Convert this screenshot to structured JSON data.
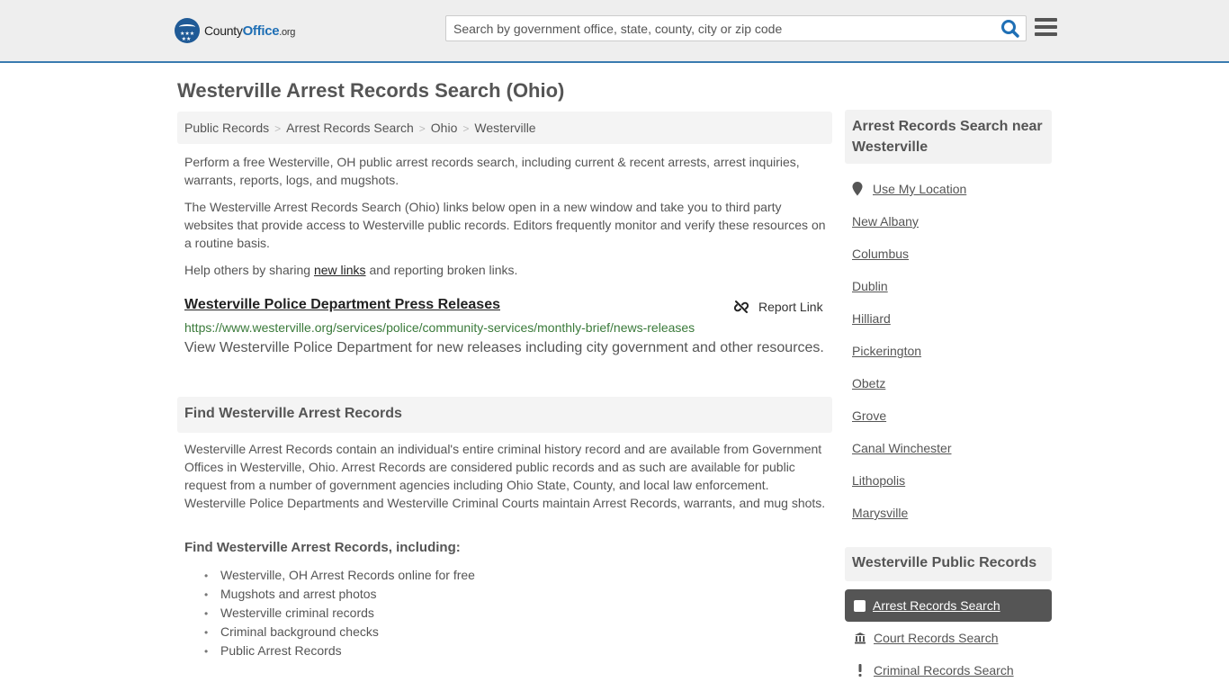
{
  "header": {
    "logo": {
      "name": "County",
      "highlight": "Office",
      "suffix": ".org"
    },
    "search": {
      "placeholder": "Search by government office, state, county, city or zip code",
      "value": ""
    },
    "icons": {
      "search": "search-icon",
      "menu": "hamburger-menu-icon"
    }
  },
  "page": {
    "title": "Westerville Arrest Records Search (Ohio)",
    "breadcrumb": [
      "Public Records",
      "Arrest Records Search",
      "Ohio",
      "Westerville"
    ],
    "intro": [
      "Perform a free Westerville, OH public arrest records search, including current & recent arrests, arrest inquiries, warrants, reports, logs, and mugshots.",
      "The Westerville Arrest Records Search (Ohio) links below open in a new window and take you to third party websites that provide access to Westerville public records. Editors frequently monitor and verify these resources on a routine basis."
    ],
    "share": {
      "before": "Help others by sharing ",
      "link": "new links",
      "after": " and reporting broken links."
    }
  },
  "result": {
    "title": "Westerville Police Department Press Releases",
    "url": "https://www.westerville.org/services/police/community-services/monthly-brief/news-releases",
    "description": "View Westerville Police Department for new releases including city government and other resources.",
    "report_label": "Report Link",
    "report_icon": "broken-link-icon"
  },
  "find_section": {
    "heading": "Find Westerville Arrest Records",
    "body": "Westerville Arrest Records contain an individual's entire criminal history record and are available from Government Offices in Westerville, Ohio. Arrest Records are considered public records and as such are available for public request from a number of government agencies including Ohio State, County, and local law enforcement. Westerville Police Departments and Westerville Criminal Courts maintain Arrest Records, warrants, and mug shots.",
    "subheading": "Find Westerville Arrest Records, including:",
    "items": [
      "Westerville, OH Arrest Records online for free",
      "Mugshots and arrest photos",
      "Westerville criminal records",
      "Criminal background checks",
      "Public Arrest Records"
    ]
  },
  "sidebar": {
    "nearby_heading": "Arrest Records Search near Westerville",
    "use_location": "Use My Location",
    "nearby": [
      "New Albany",
      "Columbus",
      "Dublin",
      "Hilliard",
      "Pickerington",
      "Obetz",
      "Grove",
      "Canal Winchester",
      "Lithopolis",
      "Marysville"
    ],
    "public_records_heading": "Westerville Public Records",
    "public_records": [
      {
        "label": "Arrest Records Search",
        "icon": "square-icon",
        "active": true
      },
      {
        "label": "Court Records Search",
        "icon": "courthouse-icon",
        "active": false
      },
      {
        "label": "Criminal Records Search",
        "icon": "exclamation-icon",
        "active": false
      }
    ]
  }
}
